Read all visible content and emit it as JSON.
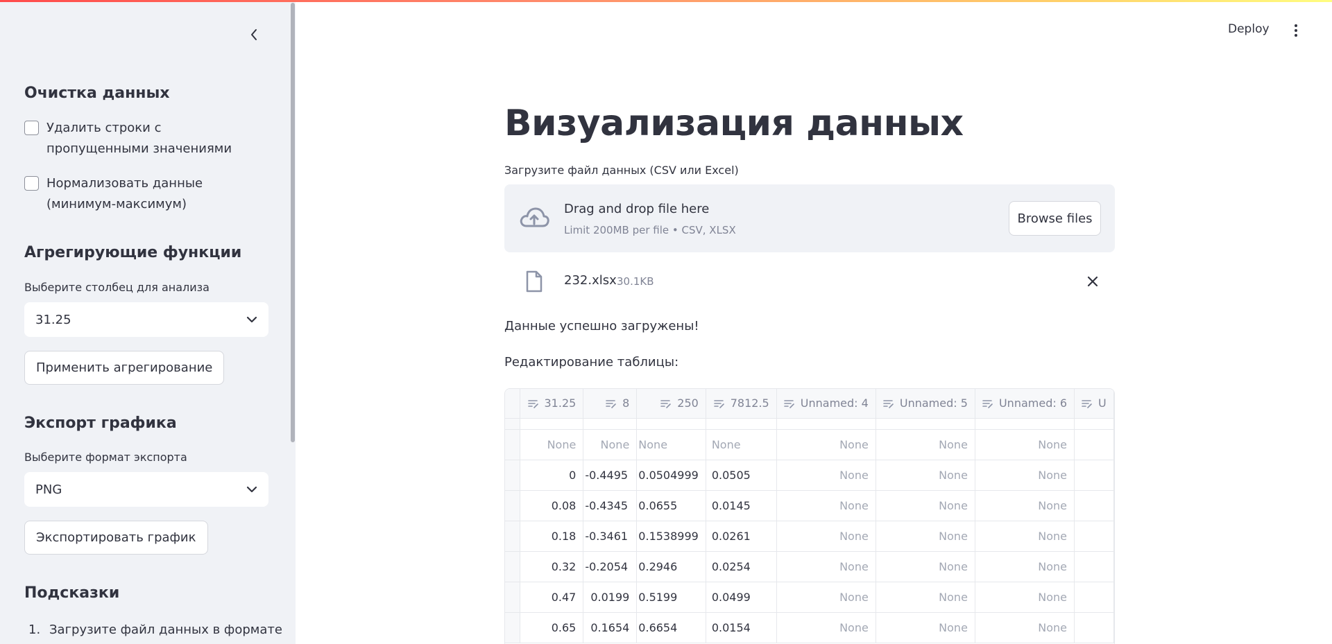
{
  "sidebar": {
    "cleaning": {
      "title": "Очистка данных",
      "drop_missing": "Удалить строки с пропущенными значениями",
      "normalize": "Нормализовать данные (минимум-максимум)"
    },
    "aggregate": {
      "title": "Агрегирующие функции",
      "column_label": "Выберите столбец для анализа",
      "column_value": "31.25",
      "apply_button": "Применить агрегирование"
    },
    "export": {
      "title": "Экспорт графика",
      "format_label": "Выберите формат экспорта",
      "format_value": "PNG",
      "export_button": "Экспортировать график"
    },
    "hints": {
      "title": "Подсказки",
      "item1_num": "1.",
      "item1": "Загрузите файл данных в формате"
    }
  },
  "header": {
    "deploy": "Deploy"
  },
  "main": {
    "title": "Визуализация данных",
    "upload_label": "Загрузите файл данных (CSV или Excel)",
    "dropzone_main": "Drag and drop file here",
    "dropzone_sub": "Limit 200MB per file • CSV, XLSX",
    "browse": "Browse files",
    "file_name": "232.xlsx",
    "file_size": "30.1KB",
    "success": "Данные успешно загружены!",
    "edit_label": "Редактирование таблицы:"
  },
  "table": {
    "columns": [
      "31.25",
      "8",
      "250",
      "7812.5",
      "Unnamed: 4",
      "Unnamed: 5",
      "Unnamed: 6",
      "U"
    ],
    "rows": [
      [
        "None",
        "None",
        "None",
        "None",
        "None",
        "None",
        "None",
        ""
      ],
      [
        "0",
        "-0.4495",
        "0.0504999",
        "0.0505",
        "None",
        "None",
        "None",
        ""
      ],
      [
        "0.08",
        "-0.4345",
        "0.0655",
        "0.0145",
        "None",
        "None",
        "None",
        ""
      ],
      [
        "0.18",
        "-0.3461",
        "0.1538999",
        "0.0261",
        "None",
        "None",
        "None",
        ""
      ],
      [
        "0.32",
        "-0.2054",
        "0.2946",
        "0.0254",
        "None",
        "None",
        "None",
        ""
      ],
      [
        "0.47",
        "0.0199",
        "0.5199",
        "0.0499",
        "None",
        "None",
        "None",
        ""
      ],
      [
        "0.65",
        "0.1654",
        "0.6654",
        "0.0154",
        "None",
        "None",
        "None",
        ""
      ]
    ]
  }
}
